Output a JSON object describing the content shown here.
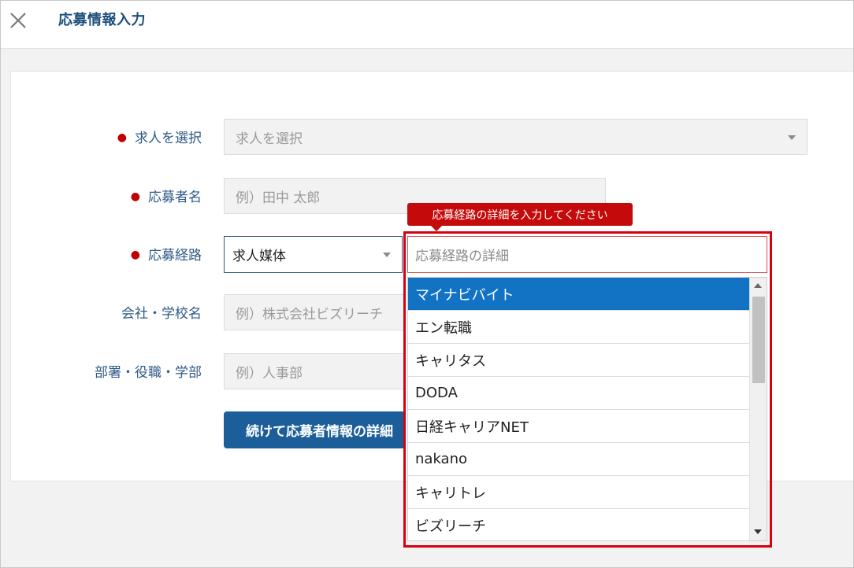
{
  "header": {
    "title": "応募情報入力",
    "close_icon": "close-icon"
  },
  "form": {
    "job": {
      "label": "求人を選択",
      "placeholder": "求人を選択"
    },
    "applicant_name": {
      "label": "応募者名",
      "placeholder": "例）田中 太郎"
    },
    "route": {
      "label": "応募経路",
      "selected": "求人媒体",
      "detail_placeholder": "応募経路の詳細"
    },
    "company": {
      "label": "会社・学校名",
      "placeholder": "例）株式会社ビズリーチ"
    },
    "department": {
      "label": "部署・役職・学部",
      "placeholder": "例）人事部"
    },
    "submit_label": "続けて応募者情報の詳細"
  },
  "tooltip": "応募経路の詳細を入力してください",
  "dropdown": {
    "options": [
      "マイナビバイト",
      "エン転職",
      "キャリタス",
      "DODA",
      "日経キャリアNET",
      "nakano",
      "キャリトレ",
      "ビズリーチ"
    ],
    "selected_index": 0
  },
  "colors": {
    "accent": "#1b5e99",
    "error": "#d8000f",
    "selected": "#1273c5",
    "label": "#2f5a86"
  }
}
